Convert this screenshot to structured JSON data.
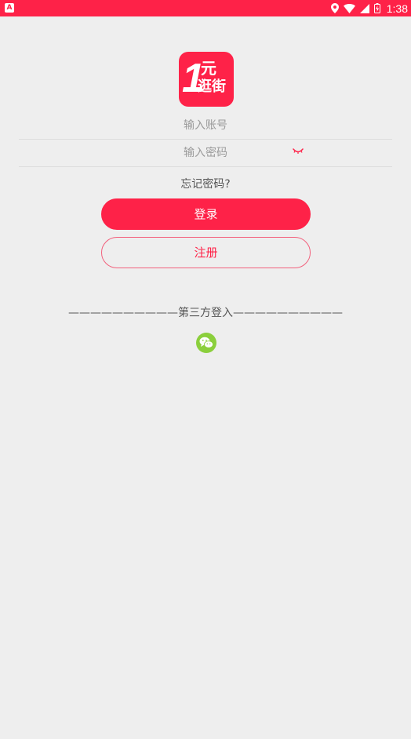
{
  "status_bar": {
    "time": "1:38",
    "background_color": "#fe2248",
    "app_icon_letter": "A",
    "icons": [
      "location-icon",
      "wifi-icon",
      "signal-icon",
      "battery-icon"
    ]
  },
  "logo": {
    "number": "1",
    "line1": "元",
    "line2": "逛街"
  },
  "form": {
    "account_placeholder": "输入账号",
    "password_placeholder": "输入密码",
    "forgot_label": "忘记密码?",
    "login_label": "登录",
    "register_label": "注册"
  },
  "third_party": {
    "label": "——————————第三方登入——————————",
    "icons": [
      "wechat-icon"
    ]
  },
  "colors": {
    "accent": "#fe2248",
    "wechat": "#8bcf3c",
    "background": "#eeeeee"
  }
}
